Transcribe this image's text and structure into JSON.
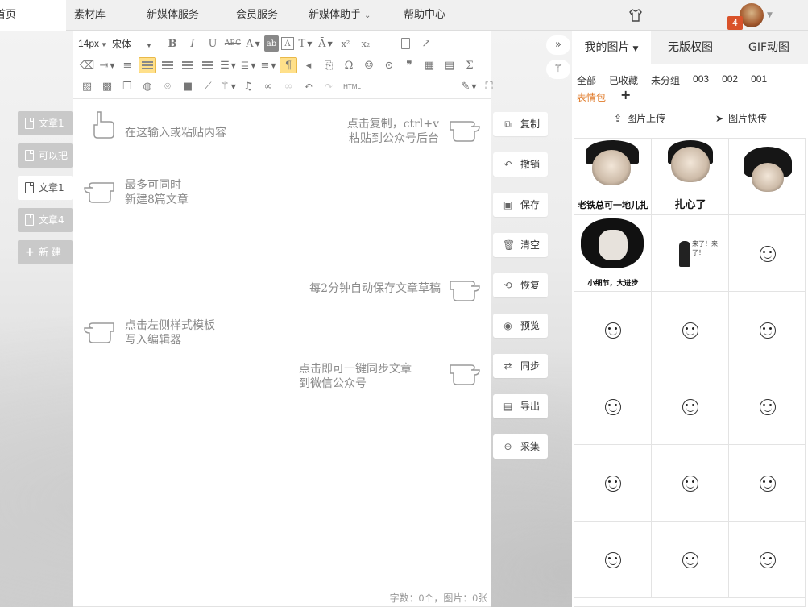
{
  "nav": {
    "items": [
      {
        "label": "首页",
        "left": 0
      },
      {
        "label": "素材库"
      },
      {
        "label": "新媒体服务"
      },
      {
        "label": "会员服务"
      },
      {
        "label": "新媒体助手"
      },
      {
        "label": "帮助中心"
      }
    ],
    "badge_count": "4"
  },
  "side_tabs": [
    {
      "label": "文章1"
    },
    {
      "label": "可以把"
    },
    {
      "label": "文章1"
    },
    {
      "label": "文章4"
    },
    {
      "label": "新 建"
    }
  ],
  "toolbar": {
    "font_size": "14px",
    "font_family": "宋体",
    "html_label": "HTML"
  },
  "hints": {
    "paste": "在这输入或粘贴内容",
    "copy_line1": "点击复制，ctrl+v",
    "copy_line2": "粘贴到公众号后台",
    "max_line1": "最多可同时",
    "max_line2": "新建8篇文章",
    "autosave": "每2分钟自动保存文章草稿",
    "template_line1": "点击左侧样式模板",
    "template_line2": "写入编辑器",
    "sync_line1": "点击即可一键同步文章",
    "sync_line2": "到微信公众号"
  },
  "wordcount": "字数：0个，图片：0张",
  "actions": [
    {
      "label": "复制",
      "icon": "copy-icon",
      "glyph": "⧉"
    },
    {
      "label": "撤销",
      "icon": "undo-icon",
      "glyph": "↶"
    },
    {
      "label": "保存",
      "icon": "save-icon",
      "glyph": "▣"
    },
    {
      "label": "清空",
      "icon": "trash-icon",
      "glyph": "🗑"
    },
    {
      "label": "恢复",
      "icon": "restore-icon",
      "glyph": "⟲"
    },
    {
      "label": "预览",
      "icon": "eye-icon",
      "glyph": "◉"
    },
    {
      "label": "同步",
      "icon": "sync-icon",
      "glyph": "⇄"
    },
    {
      "label": "导出",
      "icon": "export-icon",
      "glyph": "▤"
    },
    {
      "label": "采集",
      "icon": "collect-icon",
      "glyph": "⊕"
    }
  ],
  "image_panel": {
    "tabs": [
      "我的图片",
      "无版权图",
      "GIF动图"
    ],
    "filters": [
      "全部",
      "已收藏",
      "未分组",
      "003",
      "002",
      "001"
    ],
    "emoji_pack": "表情包",
    "upload_label": "图片上传",
    "quick_label": "图片快传",
    "captions": {
      "c1": "老铁总可一地儿扎",
      "c2": "扎心了",
      "c4": "小细节，大进步",
      "c5": "来了！来了！"
    }
  }
}
